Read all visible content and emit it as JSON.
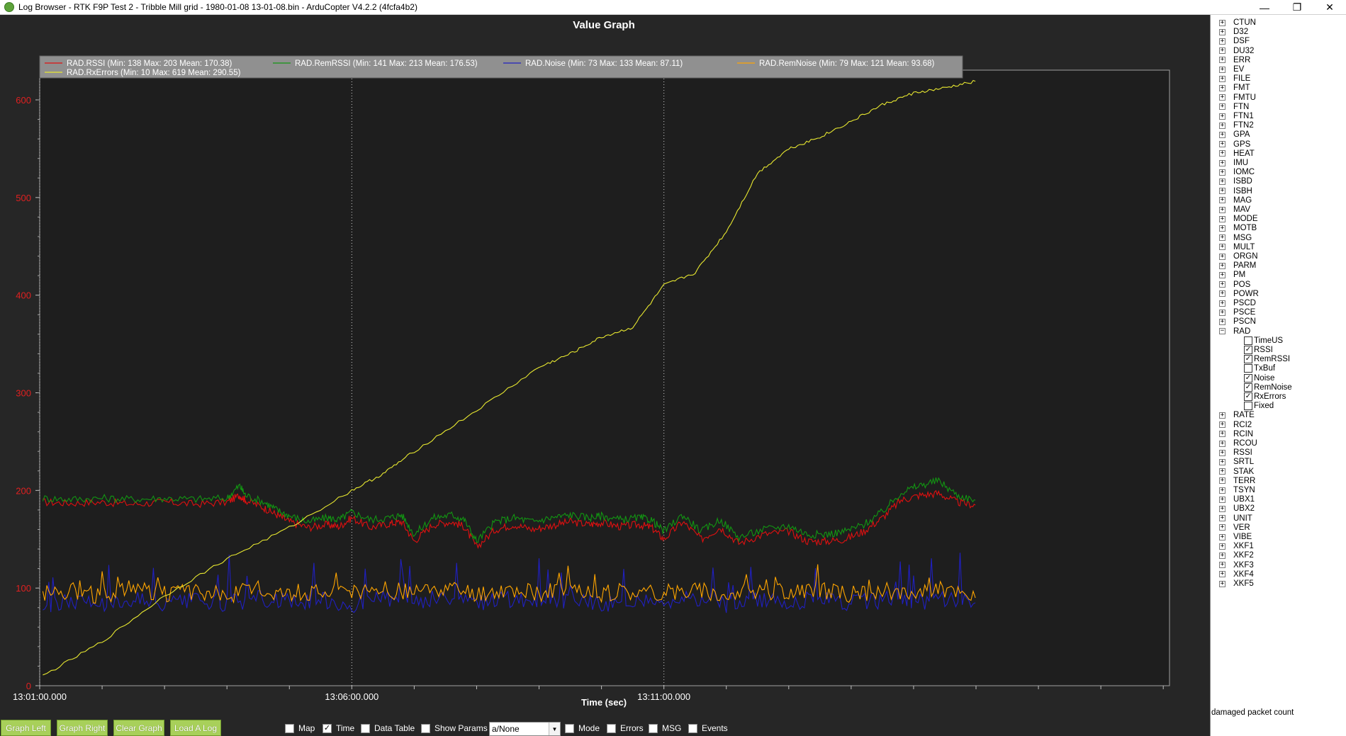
{
  "window": {
    "title": "Log Browser - RTK F9P Test 2 - Tribble Mill grid - 1980-01-08 13-01-08.bin - ArduCopter V4.2.2 (4fcfa4b2)",
    "minimize_glyph": "—",
    "maximize_glyph": "❐",
    "close_glyph": "✕"
  },
  "tree": {
    "items_before": [
      "CTUN",
      "D32",
      "DSF",
      "DU32",
      "ERR",
      "EV",
      "FILE",
      "FMT",
      "FMTU",
      "FTN",
      "FTN1",
      "FTN2",
      "GPA",
      "GPS",
      "HEAT",
      "IMU",
      "IOMC",
      "ISBD",
      "ISBH",
      "MAG",
      "MAV",
      "MODE",
      "MOTB",
      "MSG",
      "MULT",
      "ORGN",
      "PARM",
      "PM",
      "POS",
      "POWR",
      "PSCD",
      "PSCE",
      "PSCN"
    ],
    "expanded": {
      "name": "RAD",
      "fields": [
        {
          "label": "TimeUS",
          "checked": false
        },
        {
          "label": "RSSI",
          "checked": true
        },
        {
          "label": "RemRSSI",
          "checked": true
        },
        {
          "label": "TxBuf",
          "checked": false
        },
        {
          "label": "Noise",
          "checked": true
        },
        {
          "label": "RemNoise",
          "checked": true
        },
        {
          "label": "RxErrors",
          "checked": true
        },
        {
          "label": "Fixed",
          "checked": false
        }
      ]
    },
    "items_after": [
      "RATE",
      "RCI2",
      "RCIN",
      "RCOU",
      "RSSI",
      "SRTL",
      "STAK",
      "TERR",
      "TSYN",
      "UBX1",
      "UBX2",
      "UNIT",
      "VER",
      "VIBE",
      "XKF1",
      "XKF2",
      "XKF3",
      "XKF4",
      "XKF5"
    ],
    "plus_glyph": "+",
    "minus_glyph": "−",
    "check_glyph": "✓"
  },
  "status_text": "damaged packet count",
  "toolbar": {
    "buttons": [
      "Graph Left",
      "Graph Right",
      "Clear Graph",
      "Load A Log"
    ],
    "checkboxes": [
      {
        "label": "Map",
        "checked": false
      },
      {
        "label": "Time",
        "checked": true
      },
      {
        "label": "Data Table",
        "checked": false
      },
      {
        "label": "Show Params",
        "checked": false
      },
      {
        "label": "Mode",
        "checked": false
      },
      {
        "label": "Errors",
        "checked": false
      },
      {
        "label": "MSG",
        "checked": false
      },
      {
        "label": "Events",
        "checked": false
      }
    ],
    "combo_value": "a/None",
    "combo_arrow": "▼"
  },
  "chart_data": {
    "type": "line",
    "title": "Value Graph",
    "xlabel": "Time (sec)",
    "ylabel": "",
    "x_unit": "minutes from 13:01:00",
    "xlim": [
      0,
      18.1
    ],
    "ylim": [
      0,
      600
    ],
    "y_ticks": [
      0,
      100,
      200,
      300,
      400,
      500,
      600
    ],
    "x_tick_labels": [
      {
        "value": 0,
        "label": "13:01:00.000"
      },
      {
        "value": 5,
        "label": "13:06:00.000"
      },
      {
        "value": 10,
        "label": "13:11:00.000"
      }
    ],
    "grid": true,
    "legend_position": "top-left",
    "series": [
      {
        "name": "RAD.RSSI",
        "legend": "RAD.RSSI  (Min: 138 Max: 203 Mean: 170.38)",
        "color": "#e01010",
        "x": [
          0.05,
          0.5,
          1,
          1.5,
          2,
          2.5,
          3,
          3.2,
          3.3,
          3.6,
          3.8,
          4,
          4.3,
          4.6,
          4.8,
          5,
          5.3,
          5.6,
          5.8,
          6,
          6.3,
          6.6,
          6.8,
          7,
          7.3,
          7.6,
          7.9,
          8.2,
          8.5,
          8.8,
          9,
          9.3,
          9.6,
          9.8,
          10,
          10.3,
          10.6,
          10.9,
          11.2,
          11.6,
          12,
          12.3,
          12.6,
          12.9,
          13.2,
          13.5,
          13.8,
          14.1,
          14.4,
          14.7,
          14.99
        ],
        "y": [
          188,
          187,
          188,
          186,
          188,
          186,
          188,
          195,
          190,
          182,
          175,
          168,
          162,
          165,
          163,
          172,
          162,
          166,
          168,
          148,
          165,
          168,
          163,
          142,
          160,
          165,
          160,
          164,
          168,
          165,
          167,
          163,
          165,
          162,
          150,
          168,
          150,
          162,
          146,
          155,
          158,
          148,
          148,
          150,
          158,
          172,
          190,
          195,
          197,
          188,
          185
        ]
      },
      {
        "name": "RAD.RemRSSI",
        "legend": "RAD.RemRSSI  (Min: 141 Max: 213 Mean: 176.53)",
        "color": "#129612",
        "x": [
          0.05,
          0.5,
          1,
          1.5,
          2,
          2.5,
          3,
          3.2,
          3.3,
          3.6,
          3.8,
          4,
          4.3,
          4.6,
          4.8,
          5,
          5.3,
          5.6,
          5.8,
          6,
          6.3,
          6.6,
          6.8,
          7,
          7.3,
          7.6,
          7.9,
          8.2,
          8.5,
          8.8,
          9,
          9.3,
          9.6,
          9.8,
          10,
          10.3,
          10.6,
          10.9,
          11.2,
          11.6,
          12,
          12.3,
          12.6,
          12.9,
          13.2,
          13.5,
          13.8,
          14.1,
          14.4,
          14.7,
          14.99
        ],
        "y": [
          192,
          191,
          192,
          191,
          192,
          191,
          192,
          205,
          195,
          188,
          180,
          174,
          168,
          172,
          170,
          178,
          170,
          172,
          175,
          155,
          172,
          175,
          170,
          148,
          168,
          172,
          168,
          172,
          175,
          172,
          174,
          170,
          172,
          170,
          158,
          175,
          158,
          170,
          152,
          160,
          164,
          155,
          155,
          158,
          165,
          178,
          198,
          205,
          210,
          195,
          190
        ]
      },
      {
        "name": "RAD.Noise",
        "legend": "RAD.Noise  (Min: 73 Max: 133 Mean: 87.11)",
        "color": "#2020c0",
        "x": [
          0.05,
          0.5,
          1,
          1.5,
          2,
          2.5,
          3,
          3.5,
          4,
          4.5,
          5,
          5.5,
          6,
          6.5,
          7,
          7.5,
          8,
          8.5,
          9,
          9.5,
          10,
          10.5,
          11,
          11.5,
          12,
          12.5,
          13,
          13.5,
          14,
          14.5,
          14.99
        ],
        "y": [
          80,
          88,
          84,
          90,
          82,
          87,
          84,
          90,
          85,
          88,
          83,
          89,
          86,
          90,
          84,
          88,
          85,
          89,
          84,
          88,
          85,
          90,
          83,
          88,
          86,
          89,
          85,
          88,
          86,
          89,
          85
        ]
      },
      {
        "name": "RAD.RemNoise",
        "legend": "RAD.RemNoise  (Min: 79 Max: 121 Mean: 93.68)",
        "color": "#ffa500",
        "x": [
          0.05,
          0.5,
          1,
          1.5,
          2,
          2.5,
          3,
          3.5,
          4,
          4.5,
          5,
          5.5,
          6,
          6.5,
          7,
          7.5,
          8,
          8.5,
          9,
          9.5,
          10,
          10.5,
          11,
          11.5,
          12,
          12.5,
          13,
          13.5,
          14,
          14.5,
          14.99
        ],
        "y": [
          95,
          98,
          92,
          100,
          94,
          96,
          93,
          99,
          95,
          97,
          94,
          98,
          95,
          99,
          93,
          97,
          95,
          98,
          94,
          97,
          95,
          99,
          93,
          97,
          95,
          98,
          94,
          97,
          95,
          99,
          90
        ]
      },
      {
        "name": "RAD.RxErrors",
        "legend": "RAD.RxErrors  (Min: 10 Max: 619 Mean: 290.55)",
        "color": "#e8e830",
        "x": [
          0.05,
          1,
          2,
          3,
          4,
          5,
          5.5,
          6,
          7,
          8,
          8.5,
          9,
          9.5,
          10,
          10.5,
          11,
          11.5,
          12,
          12.5,
          13,
          13.5,
          14,
          14.5,
          14.99
        ],
        "y": [
          10,
          45,
          92,
          130,
          162,
          200,
          217,
          240,
          282,
          326,
          340,
          357,
          367,
          410,
          423,
          465,
          525,
          550,
          562,
          578,
          595,
          607,
          612,
          619
        ]
      }
    ]
  }
}
